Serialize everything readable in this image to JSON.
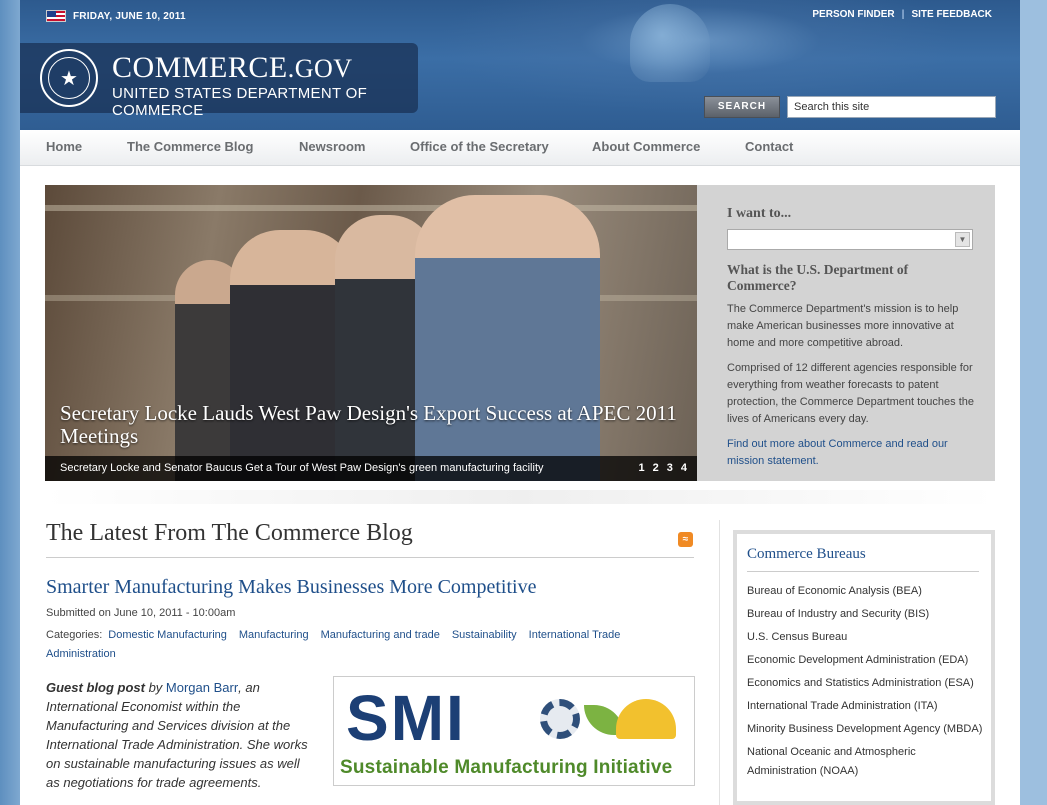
{
  "header": {
    "date": "FRIDAY, JUNE 10, 2011",
    "top_links": [
      "PERSON FINDER",
      "SITE FEEDBACK"
    ],
    "site_title_main": "COMMERCE",
    "site_title_suffix": ".GOV",
    "site_subtitle": "UNITED STATES DEPARTMENT OF COMMERCE",
    "search_button": "SEARCH",
    "search_placeholder": "Search this site",
    "flag_icon": "us-flag-icon",
    "seal_icon": "department-seal-icon"
  },
  "nav": {
    "items": [
      "Home",
      "The Commerce Blog",
      "Newsroom",
      "Office of the Secretary",
      "About Commerce",
      "Contact"
    ]
  },
  "hero": {
    "title": "Secretary Locke Lauds West Paw Design's Export Success at APEC 2011 Meetings",
    "caption": "Secretary Locke and Senator Baucus Get a Tour of West Paw Design's green manufacturing facility",
    "pages": [
      "1",
      "2",
      "3",
      "4"
    ]
  },
  "want": {
    "title": "I want to...",
    "select_value": "",
    "what_title": "What is the U.S. Department of Commerce?",
    "p1": "The Commerce Department's mission is to help make American businesses more innovative at home and more competitive abroad.",
    "p2": "Comprised of 12 different agencies responsible for everything from weather forecasts to patent protection, the Commerce Department touches the lives of Americans every day.",
    "link": "Find out more about Commerce and read our mission statement."
  },
  "blog": {
    "heading": "The Latest From The Commerce Blog",
    "post_title": "Smarter Manufacturing Makes Businesses More Competitive",
    "submitted": "Submitted on June 10, 2011 - 10:00am",
    "categories_label": "Categories:",
    "categories": [
      "Domestic Manufacturing",
      "Manufacturing",
      "Manufacturing and trade",
      "Sustainability",
      "International Trade Administration"
    ],
    "body_lead": "Guest blog post",
    "body_by": " by ",
    "author": "Morgan Barr",
    "body_rest": ", an International Economist within the Manufacturing and Services division at the International Trade Administration. She works on sustainable manufacturing issues as well as negotiations for trade agreements.",
    "smi_letters": "SMI",
    "smi_tagline": "Sustainable Manufacturing Initiative"
  },
  "bureaus": {
    "title": "Commerce Bureaus",
    "items": [
      "Bureau of Economic Analysis (BEA)",
      "Bureau of Industry and Security (BIS)",
      "U.S. Census Bureau",
      "Economic Development Administration (EDA)",
      "Economics and Statistics Administration (ESA)",
      "International Trade Administration (ITA)",
      "Minority Business Development Agency (MBDA)",
      "National Oceanic and Atmospheric Administration (NOAA)"
    ]
  },
  "colors": {
    "header_blue": "#2f5d92",
    "link_blue": "#1f4f8a",
    "panel_gray": "#d3d3d3",
    "rss_orange": "#f08a24"
  }
}
